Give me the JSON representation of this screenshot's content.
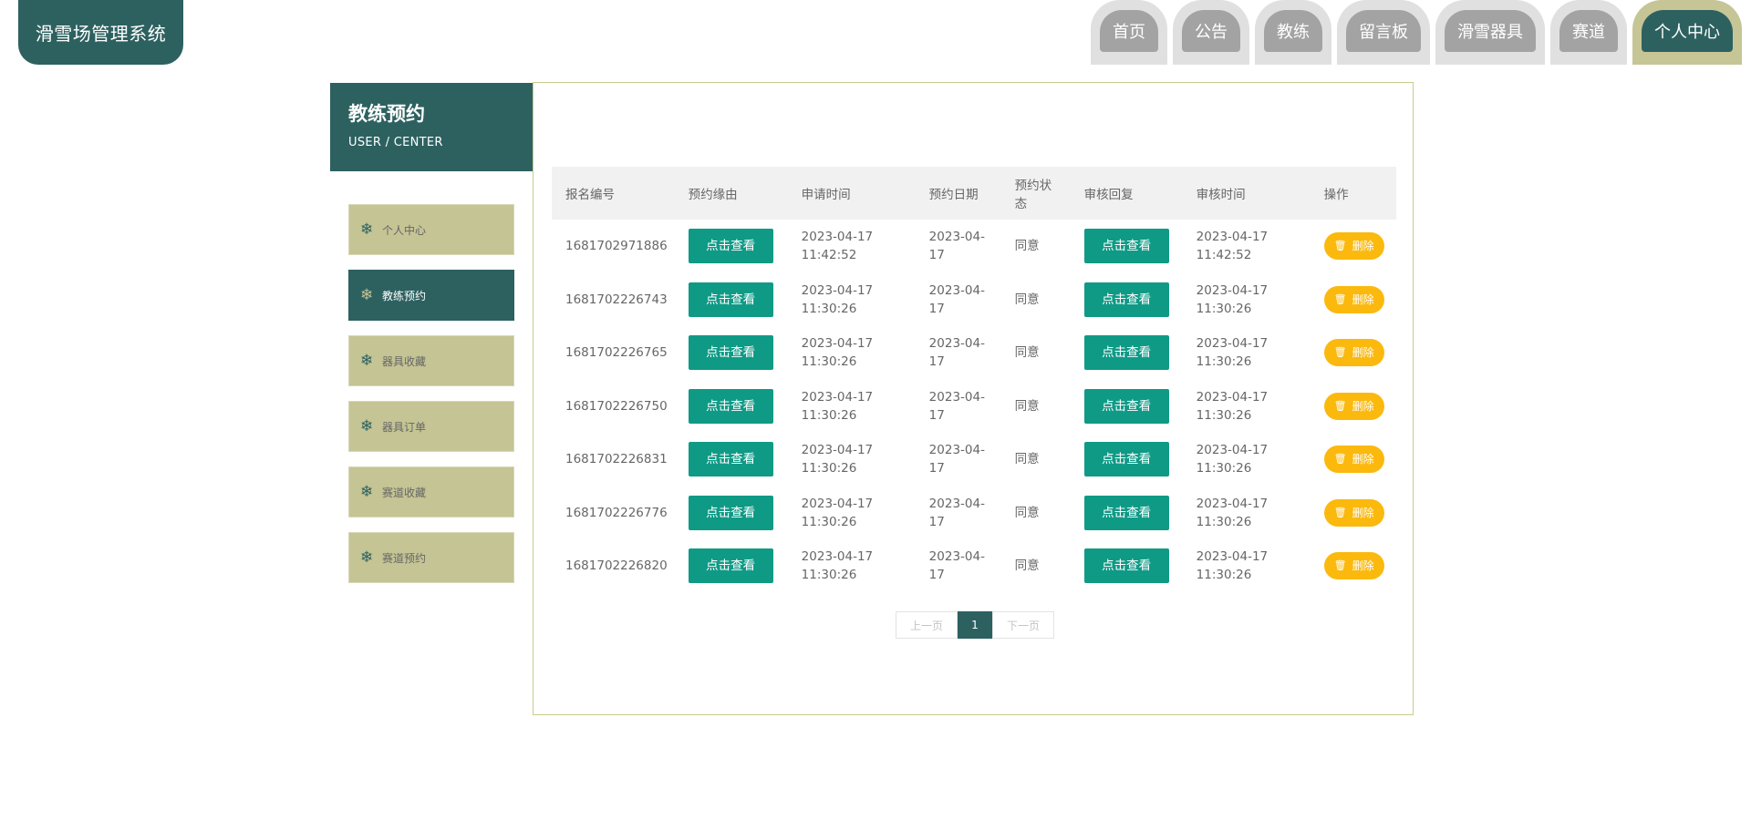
{
  "app": {
    "title": "滑雪场管理系统"
  },
  "nav": {
    "items": [
      {
        "label": "首页"
      },
      {
        "label": "公告"
      },
      {
        "label": "教练"
      },
      {
        "label": "留言板"
      },
      {
        "label": "滑雪器具"
      },
      {
        "label": "赛道"
      },
      {
        "label": "个人中心",
        "active": true
      }
    ]
  },
  "sidebar": {
    "title": "教练预约",
    "subtitle": "USER / CENTER",
    "items": [
      {
        "label": "个人中心"
      },
      {
        "label": "教练预约",
        "active": true
      },
      {
        "label": "器具收藏"
      },
      {
        "label": "器具订单"
      },
      {
        "label": "赛道收藏"
      },
      {
        "label": "赛道预约"
      }
    ]
  },
  "table": {
    "headers": {
      "no": "报名编号",
      "reason": "预约缘由",
      "apply_time": "申请时间",
      "date": "预约日期",
      "status": "预约状态",
      "reply": "审核回复",
      "audit_time": "审核时间",
      "action": "操作"
    },
    "view_label": "点击查看",
    "delete_label": "删除",
    "rows": [
      {
        "no": "1681702971886",
        "apply_time": "2023-04-17 11:42:52",
        "date": "2023-04-17",
        "status": "同意",
        "audit_time": "2023-04-17 11:42:52"
      },
      {
        "no": "1681702226743",
        "apply_time": "2023-04-17 11:30:26",
        "date": "2023-04-17",
        "status": "同意",
        "audit_time": "2023-04-17 11:30:26"
      },
      {
        "no": "1681702226765",
        "apply_time": "2023-04-17 11:30:26",
        "date": "2023-04-17",
        "status": "同意",
        "audit_time": "2023-04-17 11:30:26"
      },
      {
        "no": "1681702226750",
        "apply_time": "2023-04-17 11:30:26",
        "date": "2023-04-17",
        "status": "同意",
        "audit_time": "2023-04-17 11:30:26"
      },
      {
        "no": "1681702226831",
        "apply_time": "2023-04-17 11:30:26",
        "date": "2023-04-17",
        "status": "同意",
        "audit_time": "2023-04-17 11:30:26"
      },
      {
        "no": "1681702226776",
        "apply_time": "2023-04-17 11:30:26",
        "date": "2023-04-17",
        "status": "同意",
        "audit_time": "2023-04-17 11:30:26"
      },
      {
        "no": "1681702226820",
        "apply_time": "2023-04-17 11:30:26",
        "date": "2023-04-17",
        "status": "同意",
        "audit_time": "2023-04-17 11:30:26"
      }
    ]
  },
  "pagination": {
    "prev_label": "上一页",
    "current_page": "1",
    "next_label": "下一页"
  },
  "colors": {
    "brand": "#2d6160",
    "accent_olive": "#c4c494",
    "button_teal": "#0f9a86",
    "button_delete": "#fbb90e"
  },
  "icons": {
    "menu_item": "snowflake-icon",
    "delete": "trash-icon"
  }
}
